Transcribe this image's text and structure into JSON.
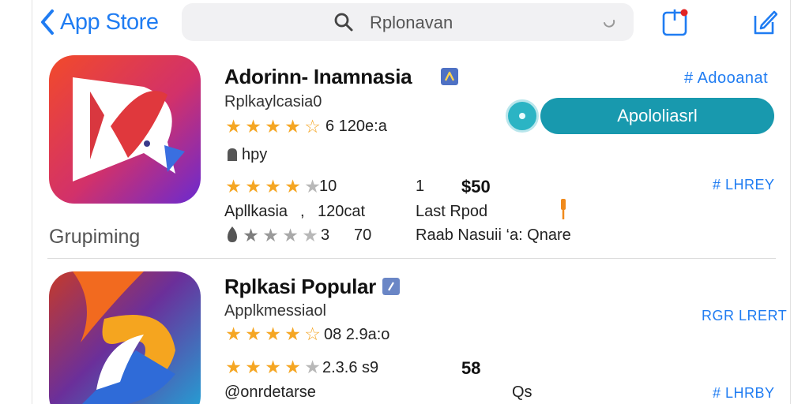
{
  "nav": {
    "back_label": "App Store"
  },
  "search": {
    "query": "Rplonavan"
  },
  "app1": {
    "title": "Adorinn‑ Inamnasia",
    "subtitle": "Rplkaylcasia0",
    "rating_text": "6 120e:a",
    "hint": "hpy",
    "link_top": "# Adooanat",
    "get_button": "Apololiasrl",
    "row2": {
      "count": "10",
      "num": "1",
      "price": "$50",
      "link": "# LHREY"
    },
    "row3": {
      "left": "Apllkasia",
      "sep": ",",
      "right": "120cat",
      "mid": "Last Rpod"
    },
    "row4": {
      "count": "3",
      "num": "70",
      "mid": "Raab Nasuii ‘a: Qnare"
    },
    "category": "Grupiming"
  },
  "app2": {
    "title": "Rplkasi Popular",
    "subtitle": "Applkmessiaol",
    "rating_text": "08 2.9a:o",
    "link_top": "RGR LRERT",
    "row2": {
      "count": "2.3.6 s9",
      "price": "58"
    },
    "row3": {
      "left": "@onrdetarse",
      "mid": "Qs",
      "link": "# LHRBY"
    }
  },
  "colors": {
    "accent": "#1f7cf2",
    "star": "#f5a623",
    "get": "#1899ae"
  }
}
